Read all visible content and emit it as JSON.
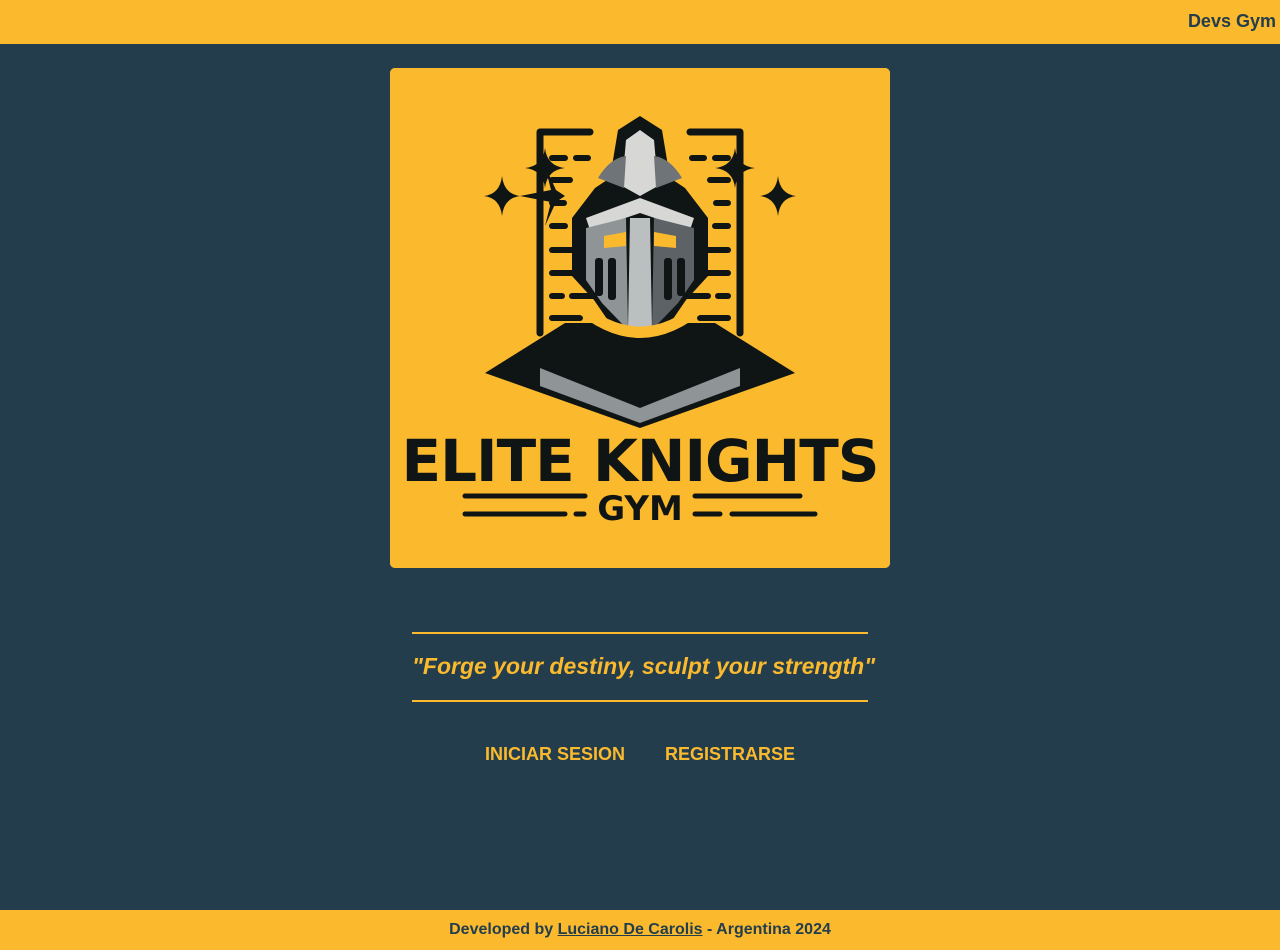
{
  "header": {
    "brand": "Devs Gym"
  },
  "logo": {
    "title_line1": "ELITE KNIGHTS",
    "title_line2": "GYM",
    "icon": "knight-helmet-icon",
    "background_color": "#fbba2d",
    "ink_color": "#0f1415"
  },
  "main": {
    "quote": "\"Forge your destiny, sculpt your strength\"",
    "buttons": [
      {
        "label": "INICIAR SESION"
      },
      {
        "label": "REGISTRARSE"
      }
    ]
  },
  "footer": {
    "prefix": "Developed by ",
    "author": "Luciano De Carolis",
    "suffix": " - Argentina 2024"
  },
  "colors": {
    "accent": "#fbba2d",
    "background": "#233d4d"
  }
}
